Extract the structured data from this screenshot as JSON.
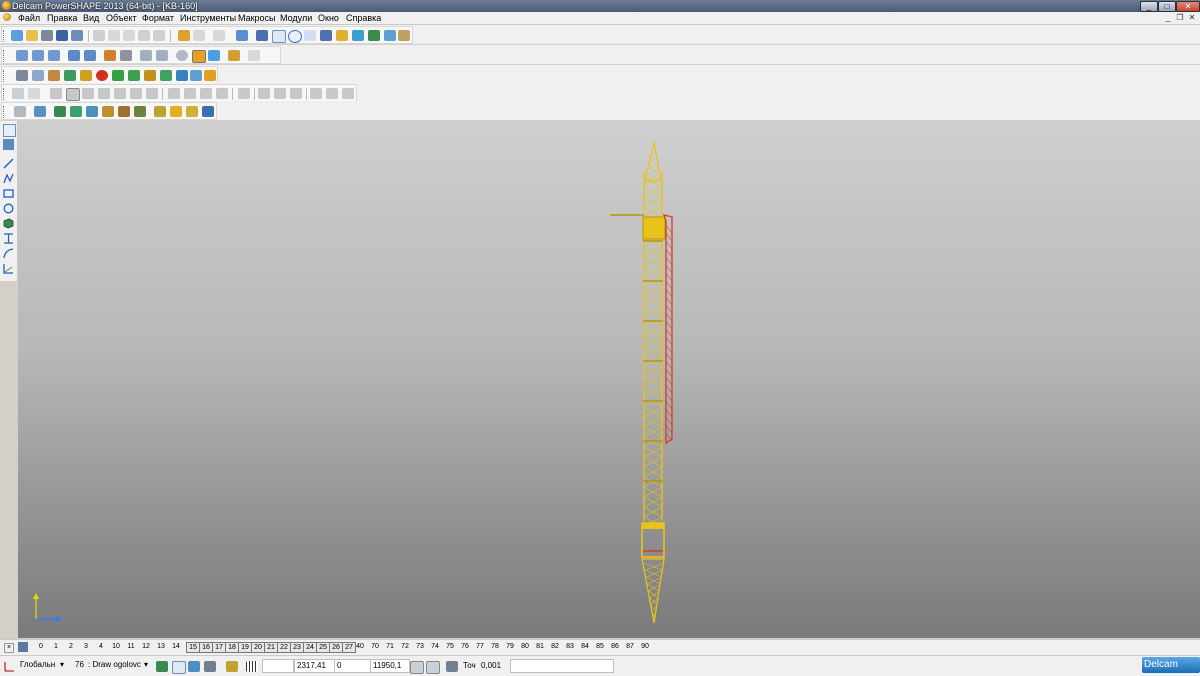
{
  "window": {
    "title": "Delcam PowerSHAPE 2013 (64-bit) - [KB-160]",
    "buttons": [
      "_",
      "□",
      "✕"
    ],
    "mdi_buttons": [
      "_",
      "❐",
      "✕"
    ]
  },
  "menu": [
    "Файл",
    "Правка",
    "Вид",
    "Объект",
    "Формат",
    "Инструменты",
    "Макросы",
    "Модули",
    "Окно",
    "Справка"
  ],
  "levels": {
    "plain": [
      "0",
      "1",
      "2",
      "3",
      "4",
      "10",
      "11",
      "12",
      "13",
      "14"
    ],
    "boxed": [
      "15",
      "16",
      "17",
      "18",
      "19",
      "20",
      "21",
      "22",
      "23",
      "24",
      "25",
      "26",
      "27"
    ],
    "tail": [
      "40",
      "70",
      "71",
      "72",
      "73",
      "74",
      "75",
      "76",
      "77",
      "78",
      "79",
      "80",
      "81",
      "82",
      "83",
      "84",
      "85",
      "86",
      "87",
      "90"
    ]
  },
  "status": {
    "workplane": "Глобальн",
    "level_number": "76",
    "level_name": ": Draw ogolovc",
    "x": "2317,41",
    "y": "0",
    "z": "11950,1",
    "tolerance_label": "Точ",
    "tolerance": "0,001",
    "brand": "Delcam"
  },
  "colors": {
    "crane": "#e8c31a",
    "crane_dark": "#b8950d",
    "cable": "#d83a2a",
    "axis_y": "#e0e000",
    "axis_x": "#2a7fff",
    "brand": "#1b6cb5"
  },
  "icons": {
    "left_toolbar": [
      "select-arrow-icon",
      "select-filter-icon",
      "line-icon",
      "polyline-icon",
      "rectangle-icon",
      "circle-icon",
      "solid-block-icon",
      "dimension-icon",
      "curve-icon",
      "workplane-icon"
    ]
  }
}
